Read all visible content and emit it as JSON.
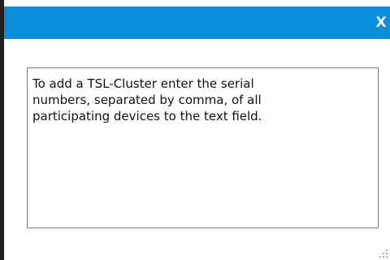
{
  "dialog": {
    "close_label": "X",
    "message_text": "To add a TSL-Cluster enter the serial\nnumbers, separated by comma, of all\nparticipating devices to the text field."
  },
  "icons": {
    "resize": "resize-grip-icon"
  },
  "colors": {
    "title_bar": "#0a8fdb",
    "left_border": "#1f1f1f",
    "text": "#111111",
    "field_border": "#7a7a7a"
  }
}
